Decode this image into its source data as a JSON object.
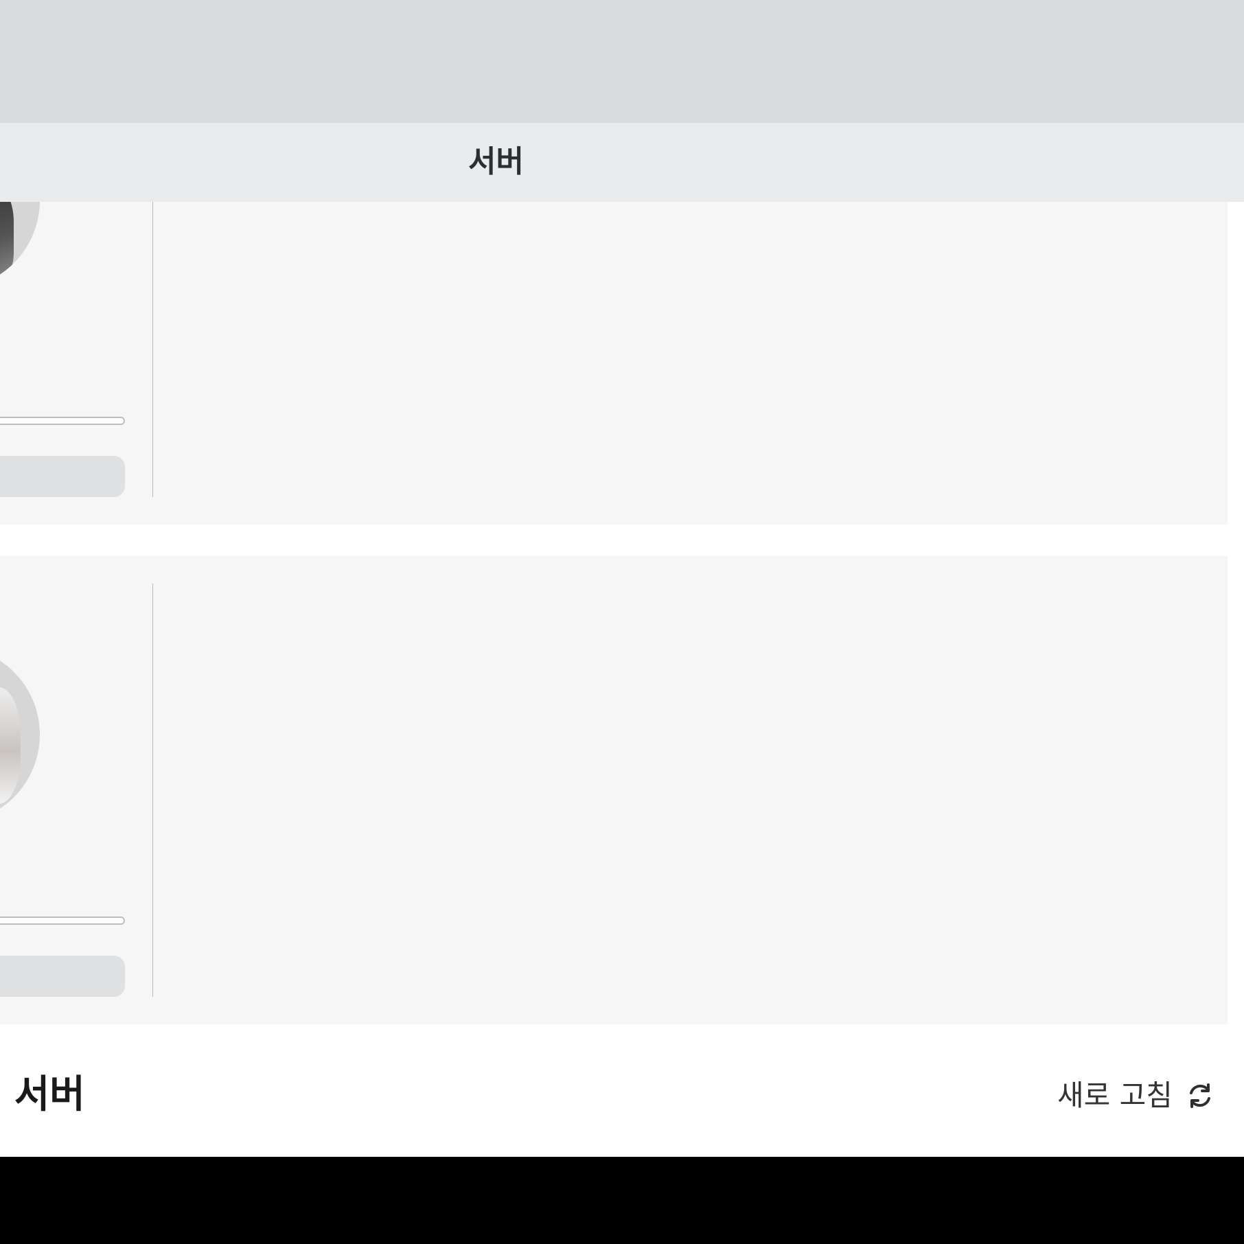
{
  "header": {
    "tab_label": "서버"
  },
  "servers": {
    "section_title": "- 서버",
    "refresh_label": "새로 고침"
  },
  "icons": {
    "refresh": "refresh-icon",
    "avatar": "avatar-image"
  },
  "colors": {
    "header_bg": "#d8dcdf",
    "tab_bar_bg": "#e8ecef",
    "card_bg": "#f6f6f6",
    "button_bg": "#dfe0e2"
  }
}
